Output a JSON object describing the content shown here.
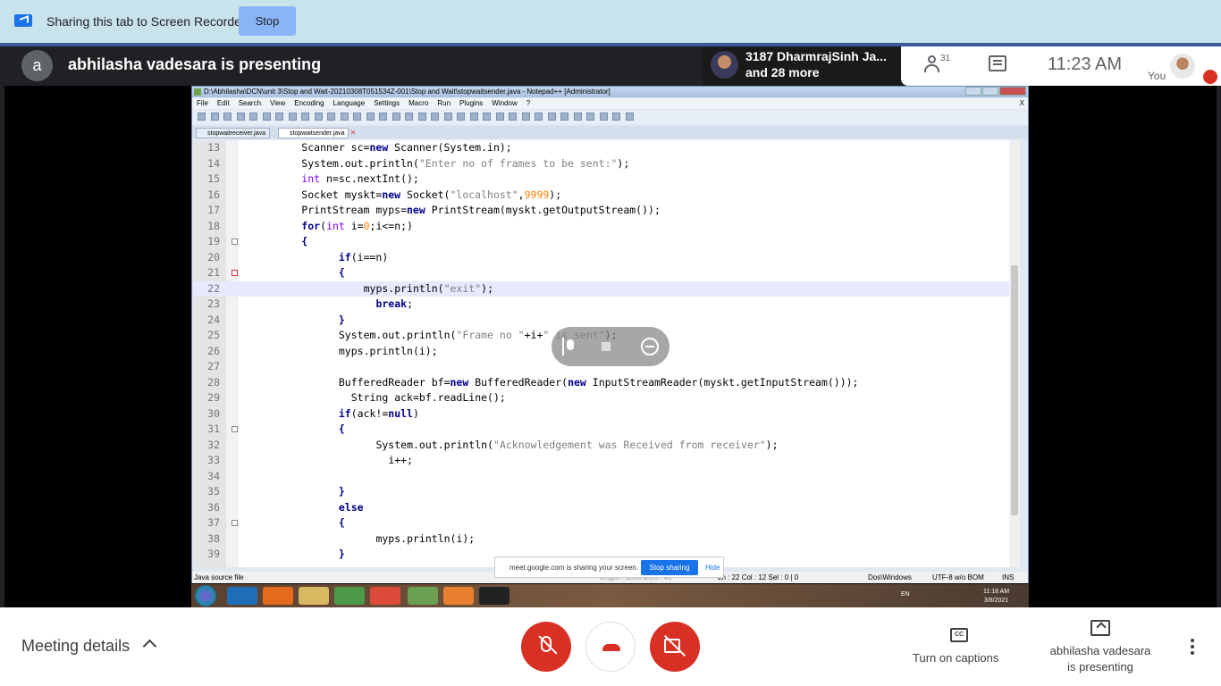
{
  "share_bar": {
    "text": "Sharing this tab to Screen Recorder",
    "stop_label": "Stop"
  },
  "meet_header": {
    "presenter_initial": "a",
    "presenter_title": "abhilasha vadesara is presenting",
    "participant_name": "3187 DharmrajSinh Ja...",
    "participant_more": "and 28 more",
    "people_count": "31",
    "time": "11:23  AM",
    "you_label": "You"
  },
  "notepad": {
    "title": "D:\\Abhilasha\\DCN\\unit 3\\Stop and Wait-20210308T051534Z-001\\Stop and Wait\\stopwaitsender.java - Notepad++ [Administrator]",
    "menu": [
      "File",
      "Edit",
      "Search",
      "View",
      "Encoding",
      "Language",
      "Settings",
      "Macro",
      "Run",
      "Plugins",
      "Window",
      "?"
    ],
    "menu_close": "X",
    "tabs": [
      {
        "label": "stopwaitreceiver.java",
        "active": false
      },
      {
        "label": "stopwaitsender.java",
        "active": true
      }
    ],
    "code_lines": [
      {
        "num": "13",
        "indent": 5,
        "html": "Scanner sc=<span class=\"kw\">new</span> Scanner(System.in);",
        "fold": ""
      },
      {
        "num": "14",
        "indent": 5,
        "html": "System.out.println(<span class=\"st\">\"Enter no of frames to be sent:\"</span>);",
        "fold": ""
      },
      {
        "num": "15",
        "indent": 5,
        "html": "<span class=\"ty\">int</span> n=sc.nextInt();",
        "fold": ""
      },
      {
        "num": "16",
        "indent": 5,
        "html": "Socket myskt=<span class=\"kw\">new</span> Socket(<span class=\"st\">\"localhost\"</span>,<span class=\"nm\">9999</span>);",
        "fold": ""
      },
      {
        "num": "17",
        "indent": 5,
        "html": "PrintStream myps=<span class=\"kw\">new</span> PrintStream(myskt.getOutputStream());",
        "fold": ""
      },
      {
        "num": "18",
        "indent": 5,
        "html": "<span class=\"kw\">for</span>(<span class=\"ty\">int</span> i=<span class=\"nm\">0</span>;i&lt;=n;)",
        "fold": ""
      },
      {
        "num": "19",
        "indent": 5,
        "html": "<span class=\"kw\">{</span>",
        "fold": "box"
      },
      {
        "num": "20",
        "indent": 8,
        "html": "<span class=\"kw\">if</span>(i==n)",
        "fold": ""
      },
      {
        "num": "21",
        "indent": 8,
        "html": "<span class=\"kw\">{</span>",
        "fold": "red"
      },
      {
        "num": "22",
        "indent": 10,
        "html": "myps.println(<span class=\"st\">\"exit\"</span>);",
        "fold": "",
        "highlight": true
      },
      {
        "num": "23",
        "indent": 11,
        "html": "<span class=\"kw\">break</span>;",
        "fold": ""
      },
      {
        "num": "24",
        "indent": 8,
        "html": "<span class=\"kw\">}</span>",
        "fold": ""
      },
      {
        "num": "25",
        "indent": 8,
        "html": "System.out.println(<span class=\"st\">\"Frame no \"</span>+i+<span class=\"st\">\" is sent\"</span>);",
        "fold": ""
      },
      {
        "num": "26",
        "indent": 8,
        "html": "myps.println(i);",
        "fold": ""
      },
      {
        "num": "27",
        "indent": 8,
        "html": "",
        "fold": ""
      },
      {
        "num": "28",
        "indent": 8,
        "html": "BufferedReader bf=<span class=\"kw\">new</span> BufferedReader(<span class=\"kw\">new</span> InputStreamReader(myskt.getInputStream()));",
        "fold": ""
      },
      {
        "num": "29",
        "indent": 9,
        "html": "String ack=bf.readLine();",
        "fold": ""
      },
      {
        "num": "30",
        "indent": 8,
        "html": "<span class=\"kw\">if</span>(ack!=<span class=\"kw\">null</span>)",
        "fold": ""
      },
      {
        "num": "31",
        "indent": 8,
        "html": "<span class=\"kw\">{</span>",
        "fold": "box"
      },
      {
        "num": "32",
        "indent": 11,
        "html": "System.out.println(<span class=\"st\">\"Acknowledgement was Received from receiver\"</span>);",
        "fold": ""
      },
      {
        "num": "33",
        "indent": 12,
        "html": "i++;",
        "fold": ""
      },
      {
        "num": "34",
        "indent": 11,
        "html": "",
        "fold": ""
      },
      {
        "num": "35",
        "indent": 8,
        "html": "<span class=\"kw\">}</span>",
        "fold": ""
      },
      {
        "num": "36",
        "indent": 8,
        "html": "<span class=\"kw\">else</span>",
        "fold": ""
      },
      {
        "num": "37",
        "indent": 8,
        "html": "<span class=\"kw\">{</span>",
        "fold": "box"
      },
      {
        "num": "38",
        "indent": 11,
        "html": "myps.println(i);",
        "fold": ""
      },
      {
        "num": "39",
        "indent": 8,
        "html": "<span class=\"kw\">}</span>",
        "fold": ""
      }
    ],
    "status": {
      "file_type": "Java source file",
      "length": "length : 1855    lines : 45",
      "position": "Ln : 22    Col : 12    Sel : 0 | 0",
      "eol": "Dos\\Windows",
      "encoding": "UTF-8 w/o BOM",
      "mode": "INS"
    }
  },
  "sharing_notice": {
    "text": "meet.google.com is sharing your screen.",
    "stop_label": "Stop sharing",
    "hide_label": "Hide"
  },
  "taskbar": {
    "lang": "EN",
    "time": "11:18 AM",
    "date": "3/8/2021"
  },
  "bottom_bar": {
    "meeting_details": "Meeting details",
    "captions_label": "Turn on captions",
    "cc_icon_text": "CC",
    "presenting_label_1": "abhilasha vadesara",
    "presenting_label_2": "is presenting"
  },
  "colors": {
    "share_bar_bg": "#c9e3ec",
    "stop_button": "#8ab4f8",
    "meet_dark": "#202124",
    "mute_red": "#d93025",
    "google_blue": "#1a73e8"
  }
}
